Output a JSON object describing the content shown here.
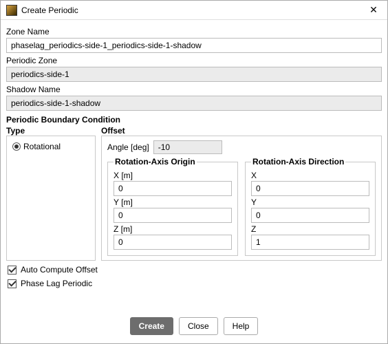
{
  "window": {
    "title": "Create Periodic"
  },
  "zone_name": {
    "label": "Zone Name",
    "value": "phaselag_periodics-side-1_periodics-side-1-shadow"
  },
  "periodic_zone": {
    "label": "Periodic Zone",
    "value": "periodics-side-1"
  },
  "shadow_name": {
    "label": "Shadow Name",
    "value": "periodics-side-1-shadow"
  },
  "pbc_title": "Periodic Boundary Condition",
  "type": {
    "heading": "Type",
    "rotational": "Rotational"
  },
  "offset": {
    "heading": "Offset",
    "angle_label": "Angle [deg]",
    "angle_value": "-10",
    "origin_title": "Rotation-Axis Origin",
    "direction_title": "Rotation-Axis Direction",
    "origin": {
      "x_label": "X [m]",
      "x": "0",
      "y_label": "Y [m]",
      "y": "0",
      "z_label": "Z [m]",
      "z": "0"
    },
    "direction": {
      "x_label": "X",
      "x": "0",
      "y_label": "Y",
      "y": "0",
      "z_label": "Z",
      "z": "1"
    }
  },
  "checks": {
    "auto_compute": "Auto Compute Offset",
    "phase_lag": "Phase Lag Periodic"
  },
  "buttons": {
    "create": "Create",
    "close": "Close",
    "help": "Help"
  }
}
